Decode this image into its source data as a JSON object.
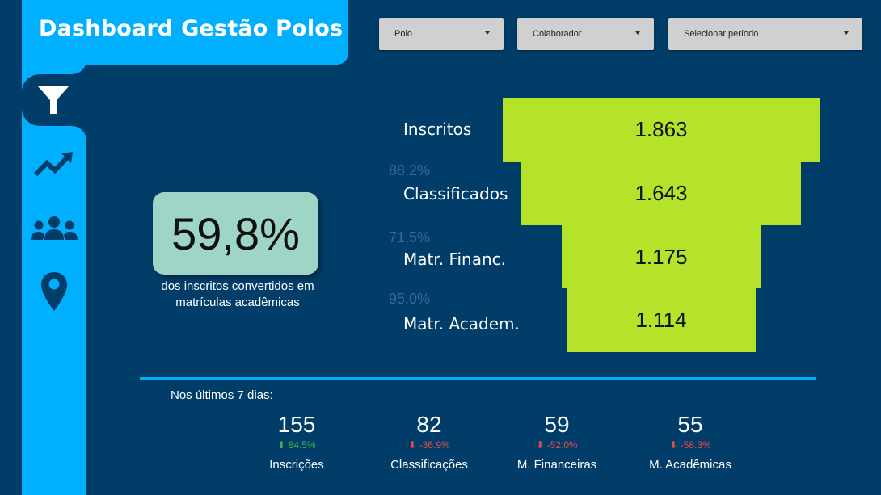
{
  "header": {
    "title": "Dashboard Gestão Polos"
  },
  "nav": [
    {
      "icon": "funnel-icon",
      "active": true
    },
    {
      "icon": "trend-icon",
      "active": false
    },
    {
      "icon": "group-icon",
      "active": false
    },
    {
      "icon": "location-pin-icon",
      "active": false
    }
  ],
  "filters": {
    "polo": "Polo",
    "colaborador": "Colaborador",
    "periodo": "Selecionar período"
  },
  "kpi": {
    "value": "59,8%",
    "caption": "dos inscritos convertidos em matrículas acadêmicas"
  },
  "funnel": {
    "stages": [
      {
        "label": "Inscritos",
        "value": "1.863"
      },
      {
        "label": "Classificados",
        "value": "1.643"
      },
      {
        "label": "Matr. Financ.",
        "value": "1.175"
      },
      {
        "label": "Matr. Academ.",
        "value": "1.114"
      }
    ],
    "rates": [
      "88,2%",
      "71,5%",
      "95,0%"
    ]
  },
  "recent": {
    "heading": "Nos últimos 7 dias:",
    "items": [
      {
        "value": "155",
        "delta": "84.5%",
        "direction": "up",
        "label": "Inscrições"
      },
      {
        "value": "82",
        "delta": "-36.9%",
        "direction": "down",
        "label": "Classificações"
      },
      {
        "value": "59",
        "delta": "-52.0%",
        "direction": "down",
        "label": "M. Financeiras"
      },
      {
        "value": "55",
        "delta": "-58.3%",
        "direction": "down",
        "label": "M. Acadêmicas"
      }
    ]
  },
  "colors": {
    "background": "#003d69",
    "accent": "#00b0ff",
    "funnel_bar": "#b5e32a",
    "kpi_box": "#9fd5c6",
    "up": "#3cb44b",
    "down": "#e24a4a"
  }
}
